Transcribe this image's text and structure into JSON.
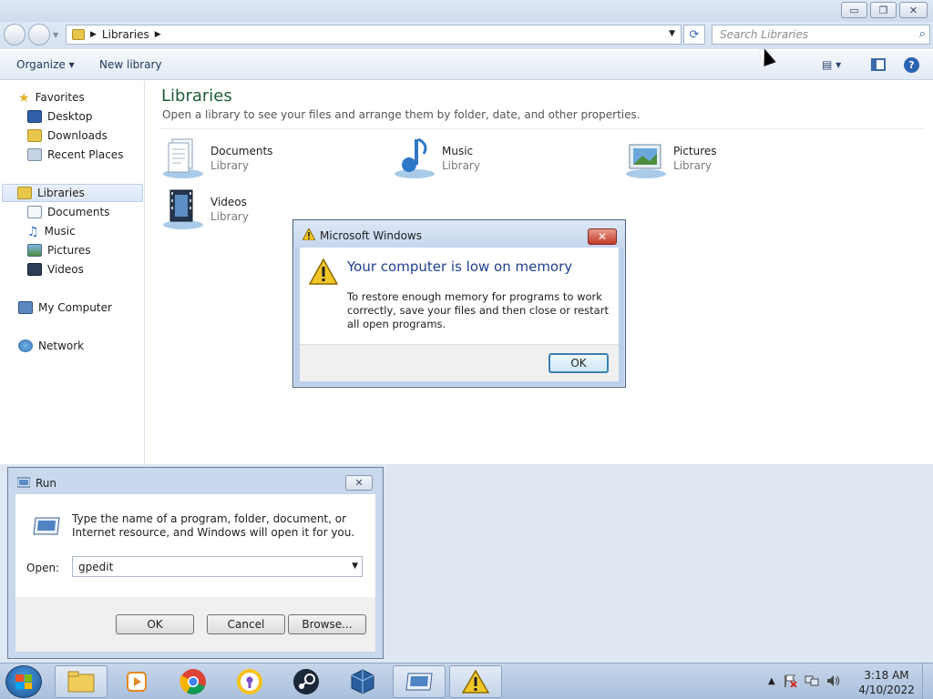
{
  "explorer": {
    "window_controls": {
      "minimize": "▭",
      "maximize": "❐",
      "close": "✕"
    },
    "address": {
      "crumb": "Libraries"
    },
    "search": {
      "placeholder": "Search Libraries"
    },
    "toolbar": {
      "organize": "Organize ▾",
      "new_library": "New library",
      "views": "▤ ▾",
      "help": "?"
    },
    "nav": {
      "favorites": "Favorites",
      "desktop": "Desktop",
      "downloads": "Downloads",
      "recent": "Recent Places",
      "libraries": "Libraries",
      "documents": "Documents",
      "music": "Music",
      "pictures": "Pictures",
      "videos": "Videos",
      "computer": "My Computer",
      "network": "Network"
    },
    "main": {
      "title": "Libraries",
      "description": "Open a library to see your files and arrange them by folder, date, and other properties.",
      "items": [
        {
          "name": "Documents",
          "type": "Library"
        },
        {
          "name": "Music",
          "type": "Library"
        },
        {
          "name": "Pictures",
          "type": "Library"
        },
        {
          "name": "Videos",
          "type": "Library"
        }
      ]
    }
  },
  "dialog": {
    "title": "Microsoft Windows",
    "heading": "Your computer is low on memory",
    "message": "To restore enough memory for programs to work correctly, save your files and then close or restart all open programs.",
    "ok": "OK",
    "close": "✕"
  },
  "run": {
    "title": "Run",
    "description": "Type the name of a program, folder, document, or Internet resource, and Windows will open it for you.",
    "open_label": "Open:",
    "input_value": "gpedit",
    "ok": "OK",
    "cancel": "Cancel",
    "browse": "Browse...",
    "close": "✕"
  },
  "taskbar": {
    "time": "3:18 AM",
    "date": "4/10/2022",
    "tray_arrow": "▲"
  }
}
